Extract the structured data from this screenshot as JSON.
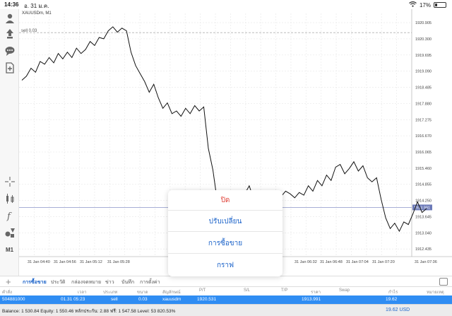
{
  "status_bar": {
    "time": "14:36",
    "date": "อ. 31 ม.ค.",
    "battery": "17%"
  },
  "toolbar": {
    "timeframe_label": "M1"
  },
  "chart": {
    "symbol_title": "XAUUSDm, M1",
    "sell_label": "sell 0.03",
    "bid_tag": "1913.991"
  },
  "chart_data": {
    "type": "line",
    "series": [
      {
        "values": [
          1918.75,
          1918.9,
          1919.2,
          1919.05,
          1919.45,
          1919.35,
          1919.6,
          1919.4,
          1919.75,
          1919.55,
          1919.8,
          1919.6,
          1919.95,
          1919.75,
          1919.9,
          1920.2,
          1920.05,
          1920.35,
          1920.3,
          1920.6,
          1920.75,
          1920.55,
          1920.7,
          1920.6,
          1919.8,
          1919.3,
          1919.0,
          1918.7,
          1918.3,
          1918.6,
          1918.1,
          1917.7,
          1917.9,
          1917.5,
          1917.6,
          1917.4,
          1917.7,
          1917.5,
          1917.8,
          1917.6,
          1917.75,
          1916.2,
          1915.4,
          1914.2,
          1914.4,
          1914.0,
          1914.3,
          1914.1,
          1914.4,
          1914.5,
          1914.8,
          1914.3,
          1914.6,
          1914.2,
          1914.1,
          1914.0,
          1914.15,
          1914.4,
          1914.6,
          1914.5,
          1914.35,
          1914.55,
          1914.45,
          1914.8,
          1914.6,
          1915.0,
          1914.8,
          1915.2,
          1915.0,
          1915.5,
          1915.6,
          1915.25,
          1915.45,
          1915.7,
          1915.35,
          1915.55,
          1915.1,
          1914.95,
          1915.1,
          1914.3,
          1913.6,
          1913.2,
          1913.4,
          1913.1,
          1913.45,
          1913.35,
          1913.75,
          1914.2,
          1913.8,
          1913.95
        ]
      }
    ],
    "y_ticks": [
      "1920.905",
      "1920.300",
      "1919.695",
      "1919.090",
      "1918.485",
      "1917.880",
      "1917.275",
      "1916.670",
      "1916.065",
      "1915.460",
      "1914.855",
      "1914.250",
      "1913.645",
      "1913.040",
      "1912.435"
    ],
    "x_ticks": [
      "31 Jan 04:40",
      "31 Jan 04:56",
      "31 Jan 05:12",
      "31 Jan 05:28",
      "31 Jan 06:32",
      "31 Jan 06:48",
      "31 Jan 07:04",
      "31 Jan 07:20",
      "31 Jan 07:36"
    ],
    "ylim": [
      1912.15,
      1921.25
    ],
    "sell_level": 1920.531,
    "bid_level": 1913.991,
    "grid": true
  },
  "tabs": [
    {
      "label": "การซื้อขาย",
      "active": true
    },
    {
      "label": "ประวัติ",
      "active": false
    },
    {
      "label": "กล่องจดหมาย",
      "active": false
    },
    {
      "label": "ข่าว",
      "active": false
    },
    {
      "label": "บันทึก",
      "active": false
    },
    {
      "label": "การตั้งค่า",
      "active": false
    }
  ],
  "columns": [
    "คำสั่ง",
    "เวลา",
    "ประเภท",
    "ขนาด",
    "สัญลักษณ์",
    "P/T",
    "S/L",
    "T/P",
    "ราคา",
    "Swap",
    "กำไร",
    "หมายเหตุ"
  ],
  "order_row": {
    "ticket": "504881000",
    "time": "01.31 05:23",
    "type": "sell",
    "size": "0.03",
    "symbol": "xauusdm",
    "open_price": "1920.531",
    "price": "1913.991",
    "profit": "19.62"
  },
  "balance_bar": {
    "text": "Balance: 1 530.84 Equity: 1 550.46 หลักประกัน: 2.88 ฟรี: 1 547.58 Level: 53 820.53%",
    "profit": "19.62  USD"
  },
  "action_sheet": {
    "close": "ปิด",
    "modify": "ปรับเปลี่ยน",
    "trade": "การซื้อขาย",
    "chart": "กราฟ"
  },
  "colors": {
    "accent": "#1a62c9",
    "row_highlight": "#2f8df3",
    "close_red": "#e0433a",
    "line": "#111111"
  }
}
